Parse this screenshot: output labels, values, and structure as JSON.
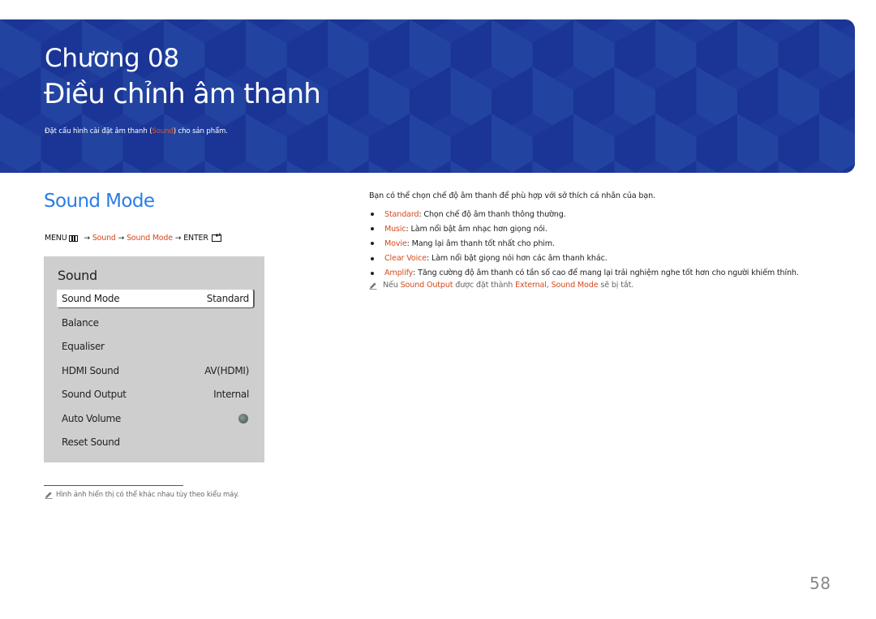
{
  "banner": {
    "chapter": "Chương 08",
    "title": "Điều chỉnh âm thanh",
    "description_before": "Đặt cấu hình cài đặt âm thanh (",
    "description_highlight": "Sound",
    "description_after": ") cho sản phẩm.",
    "colors": {
      "background": "#1e3a9a",
      "highlight": "#e05a2a"
    }
  },
  "section": {
    "title": "Sound Mode",
    "menu_path": {
      "menu_label": "MENU",
      "menu_icon": "menu-icon",
      "arrow": "→",
      "step1": "Sound",
      "step2": "Sound Mode",
      "enter_label": "ENTER",
      "enter_icon": "enter-icon"
    }
  },
  "panel": {
    "title": "Sound",
    "rows": [
      {
        "label": "Sound Mode",
        "value": "Standard",
        "selected": true
      },
      {
        "label": "Balance",
        "value": ""
      },
      {
        "label": "Equaliser",
        "value": ""
      },
      {
        "label": "HDMI Sound",
        "value": "AV(HDMI)"
      },
      {
        "label": "Sound Output",
        "value": "Internal"
      },
      {
        "label": "Auto Volume",
        "value": "",
        "toggle": "off"
      },
      {
        "label": "Reset Sound",
        "value": ""
      }
    ]
  },
  "footnote": {
    "icon": "pencil-icon",
    "text": "Hình ảnh hiển thị có thể khác nhau tùy theo kiểu máy."
  },
  "content": {
    "intro": "Bạn có thể chọn chế độ âm thanh để phù hợp với sở thích cá nhân của bạn.",
    "bullets": [
      {
        "term": "Standard",
        "desc": ": Chọn chế độ âm thanh thông thường."
      },
      {
        "term": "Music",
        "desc": ": Làm nổi bật âm nhạc hơn giọng nói."
      },
      {
        "term": "Movie",
        "desc": ": Mang lại âm thanh tốt nhất cho phim."
      },
      {
        "term": "Clear Voice",
        "desc": ": Làm nổi bật giọng nói hơn các âm thanh khác."
      },
      {
        "term": "Amplify",
        "desc": ": Tăng cường độ âm thanh có tần số cao để mang lại trải nghiệm nghe tốt hơn cho người khiếm thính."
      }
    ],
    "note": {
      "icon": "pencil-icon",
      "part1": "Nếu ",
      "term1": "Sound Output",
      "part2": " được đặt thành ",
      "term2": "External",
      "part3": ", ",
      "term3": "Sound Mode",
      "part4": " sẽ bị tắt."
    },
    "highlight_color": "#d44a1e"
  },
  "page_number": "58"
}
